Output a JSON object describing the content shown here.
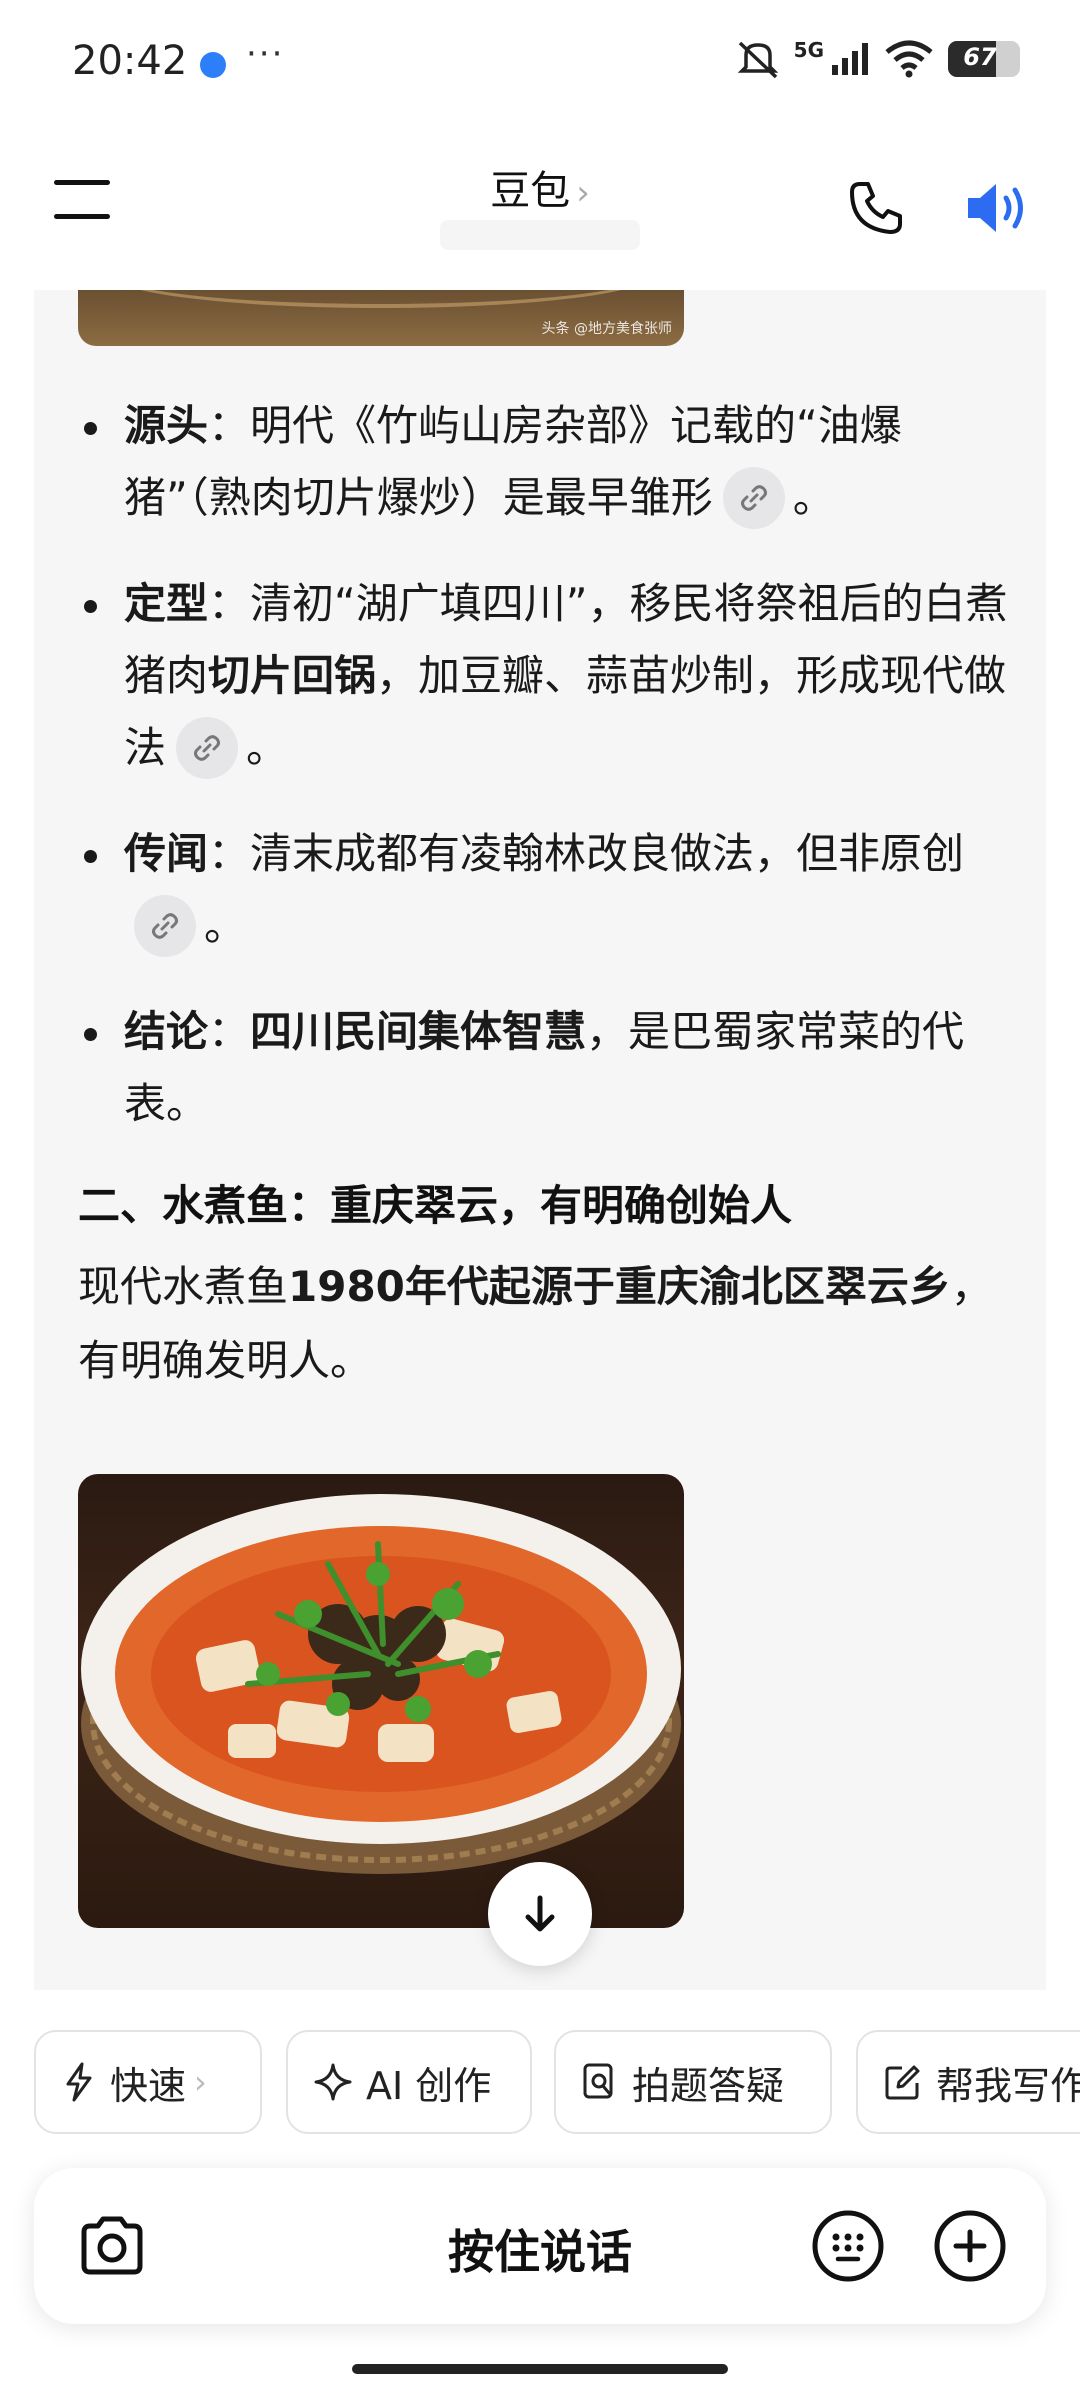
{
  "status_bar": {
    "time": "20:42",
    "more": "···",
    "network": "5G",
    "battery": "67",
    "battery_level": 0.67
  },
  "header": {
    "title": "豆包",
    "title_chevron": "›"
  },
  "content": {
    "image_watermark": "头条 @地方美食张师",
    "bullets": [
      {
        "term": "源头",
        "sep": "：",
        "text": "明代《竹屿山房杂部》记载的“油爆猪”（熟肉切片爆炒）是最早雏形",
        "end": "。"
      },
      {
        "term": "定型",
        "sep": "：",
        "text_a": "清初“湖广填四川”，移民将祭祖后的白煮猪肉",
        "bold": "切片回锅",
        "text_b": "，加豆瓣、蒜苗炒制，形成现代做法",
        "end": "。"
      },
      {
        "term": "传闻",
        "sep": "：",
        "text": "清末成都有凌翰林改良做法，但非原创",
        "end": "。"
      },
      {
        "term": "结论",
        "sep": "：",
        "bold": "四川民间集体智慧",
        "text": "，是巴蜀家常菜的代表。"
      }
    ],
    "section_heading": "二、水煮鱼：重庆翠云，有明确创始人",
    "para_a": "现代水煮鱼",
    "para_bold": "1980年代起源于重庆渝北区翠云乡",
    "para_b": "，有明确发明人。"
  },
  "chips": [
    {
      "label": "快速",
      "icon": "lightning-icon",
      "chevron": "›"
    },
    {
      "label": "AI 创作",
      "icon": "sparkle-icon"
    },
    {
      "label": "拍题答疑",
      "icon": "search-doc-icon"
    },
    {
      "label": "帮我写作",
      "icon": "edit-icon"
    }
  ],
  "input_bar": {
    "talk_label": "按住说话"
  },
  "colors": {
    "accent_blue": "#2d6cf0",
    "content_bg": "#f6f6f7"
  }
}
